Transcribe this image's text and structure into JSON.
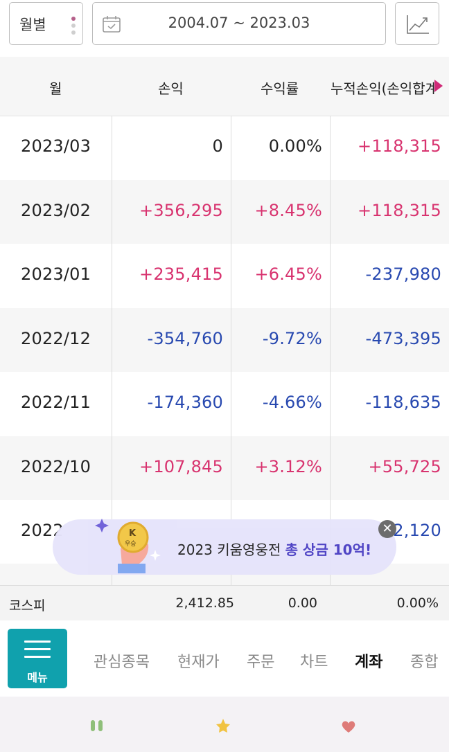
{
  "filter": {
    "period_type": "월별",
    "date_range": "2004.07 ~ 2023.03"
  },
  "table": {
    "headers": [
      "월",
      "손익",
      "수익률",
      "누적손익(손익합계"
    ],
    "rows": [
      {
        "month": "2023/03",
        "pl": "0",
        "rate": "0.00%",
        "cum": "+118,315",
        "pl_sign": "zero",
        "rate_sign": "zero",
        "cum_sign": "pos"
      },
      {
        "month": "2023/02",
        "pl": "+356,295",
        "rate": "+8.45%",
        "cum": "+118,315",
        "pl_sign": "pos",
        "rate_sign": "pos",
        "cum_sign": "pos"
      },
      {
        "month": "2023/01",
        "pl": "+235,415",
        "rate": "+6.45%",
        "cum": "-237,980",
        "pl_sign": "pos",
        "rate_sign": "pos",
        "cum_sign": "neg"
      },
      {
        "month": "2022/12",
        "pl": "-354,760",
        "rate": "-9.72%",
        "cum": "-473,395",
        "pl_sign": "neg",
        "rate_sign": "neg",
        "cum_sign": "neg"
      },
      {
        "month": "2022/11",
        "pl": "-174,360",
        "rate": "-4.66%",
        "cum": "-118,635",
        "pl_sign": "neg",
        "rate_sign": "neg",
        "cum_sign": "neg"
      },
      {
        "month": "2022/10",
        "pl": "+107,845",
        "rate": "+3.12%",
        "cum": "+55,725",
        "pl_sign": "pos",
        "rate_sign": "pos",
        "cum_sign": "pos"
      },
      {
        "month": "2022",
        "pl": "",
        "rate": "",
        "cum": "2,120",
        "pl_sign": "zero",
        "rate_sign": "zero",
        "cum_sign": "neg"
      }
    ]
  },
  "kospi": {
    "label": "코스피",
    "value": "2,412.85",
    "change": "0.00",
    "rate": "0.00%"
  },
  "banner": {
    "text_plain": "2023 키움영웅전 ",
    "text_bold": "총 상금 10억!",
    "badge_top": "K",
    "badge_bottom": "우승"
  },
  "bottom_nav": {
    "menu_label": "메뉴",
    "items": [
      "관심종목",
      "현재가",
      "주문",
      "차트",
      "계좌",
      "종합"
    ],
    "active": "계좌"
  },
  "colors": {
    "positive": "#d8336f",
    "negative": "#2849b0",
    "accent": "#10a1ad",
    "banner_emphasis": "#4b3fc4"
  },
  "icons": [
    "calendar-icon",
    "line-chart-icon",
    "hamburger-icon",
    "close-icon",
    "header-scroll-arrow-icon",
    "system-nav-icons"
  ]
}
